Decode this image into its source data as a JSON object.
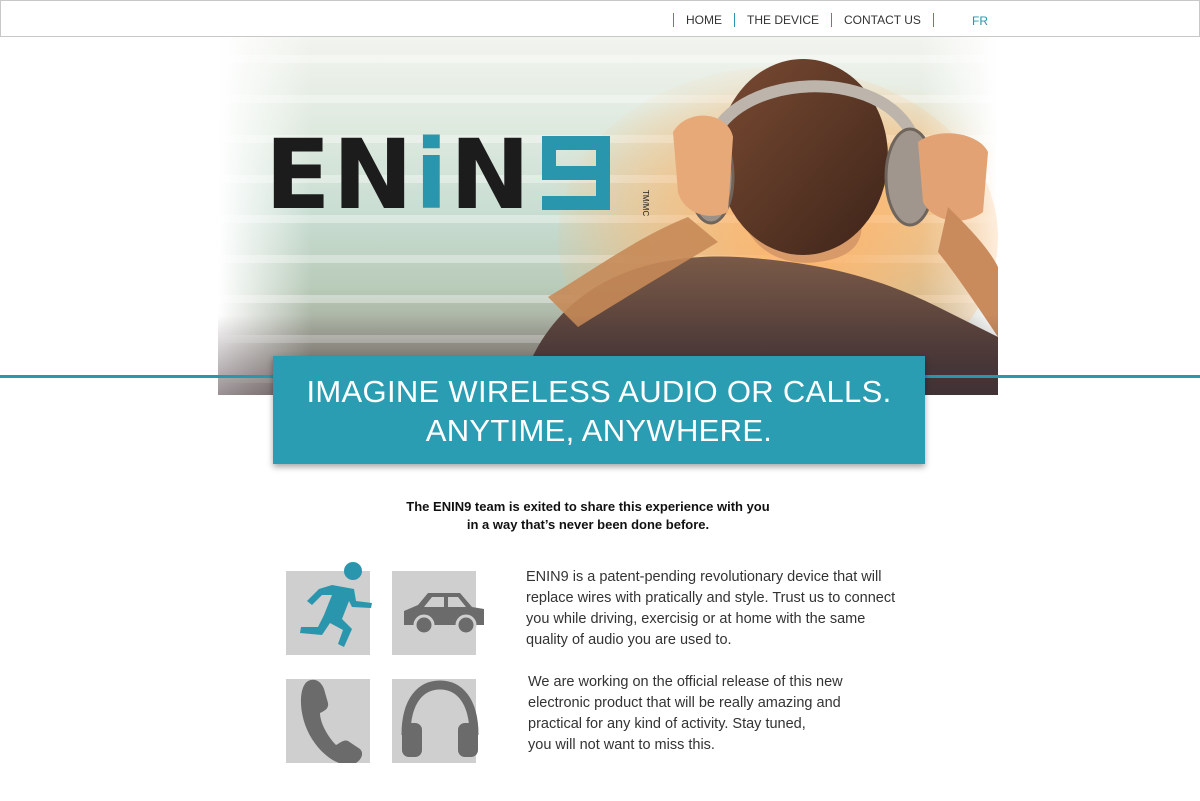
{
  "nav": {
    "items": [
      {
        "label": "HOME"
      },
      {
        "label": "THE DEVICE"
      },
      {
        "label": "CONTACT US"
      }
    ],
    "lang": "FR"
  },
  "hero": {
    "logo_main": "ENIN",
    "logo_accent_letter": "i",
    "logo_tm": "TM/MC"
  },
  "banner": {
    "line1": "IMAGINE WIRELESS AUDIO OR CALLS.",
    "line2": "ANYTIME, ANYWHERE."
  },
  "intro": {
    "line1": "The ENIN9 team is exited to share this experience with you",
    "line2": "in a way that’s never been done before."
  },
  "features": [
    {
      "icon": "running-icon"
    },
    {
      "icon": "car-icon"
    },
    {
      "icon": "phone-icon"
    },
    {
      "icon": "headphones-icon"
    }
  ],
  "content": {
    "paragraph1": "ENIN9 is a patent-pending revolutionary device that will\nreplace wires with pratically and style. Trust us to connect\nyou while driving, exercisig or at home with the same\nquality of audio you are used to.",
    "paragraph2": "We are working on the official release of this new\nelectronic product that will be really amazing and\npractical for any kind of activity. Stay tuned,\n you will not want to miss this."
  },
  "colors": {
    "accent": "#2a96ad",
    "banner": "#2a9db2",
    "icon_bg": "#cfcfcf",
    "icon_gray": "#6b6b6b"
  }
}
